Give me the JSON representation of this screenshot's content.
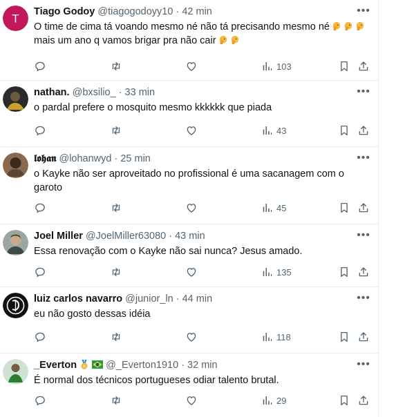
{
  "tweets": [
    {
      "name": "Tiago Godoy",
      "handle": "@tiagogodoyy10",
      "time": "· 42 min",
      "text1": "O time de cima tá voando mesmo né não tá precisando mesmo né",
      "text2": "mais um ano q vamos brigar pra não cair",
      "views": "103",
      "avatar_letter": "T",
      "avatar_color": "#c2185b",
      "icon": "facepalm-emoji"
    },
    {
      "name": "nathan.",
      "handle": "@bxsilio_",
      "time": "· 33 min",
      "text1": "o pardal prefere o mosquito mesmo kkkkkk que piada",
      "views": "43"
    },
    {
      "name": "𝖑𝖔𝖍𝖆𝖓",
      "handle": "@lohanwyd",
      "time": "· 25 min",
      "text1": "o Kayke não ser aproveitado no profissional é uma sacanagem com o",
      "text2": "garoto",
      "views": "45"
    },
    {
      "name": "Joel Miller",
      "handle": "@JoelMiller63080",
      "time": "· 43 min",
      "text1": "Essa renovação com o Kayke não sai nunca? Jesus amado.",
      "views": "135"
    },
    {
      "name": "luiz carlos navarro",
      "handle": "@junior_ln",
      "time": "· 44 min",
      "text1": "eu não gosto dessas idéia",
      "views": "118"
    },
    {
      "name": "_Everton",
      "handle": "@_Everton1910",
      "time": "· 32 min",
      "text1": "É normal dos técnicos portugueses odiar talento brutal.",
      "views": "29"
    }
  ],
  "colors": {
    "text": "#0f1419",
    "secondary": "#536471",
    "divider": "#e6ecf0"
  }
}
